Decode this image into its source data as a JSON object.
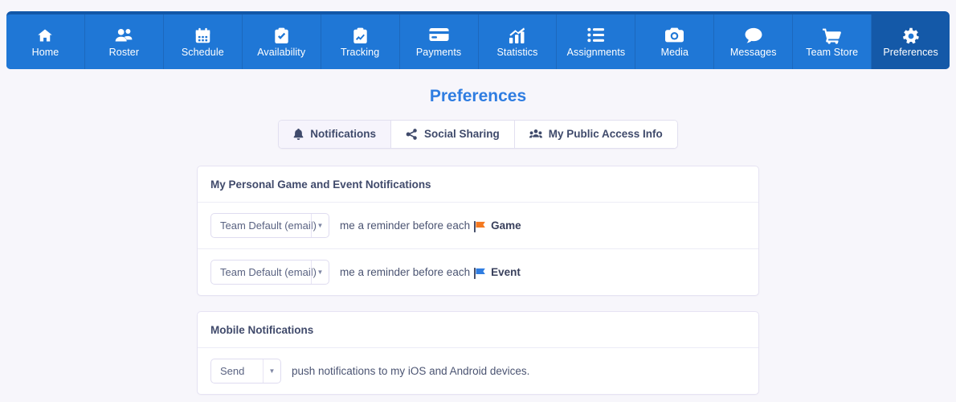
{
  "nav": {
    "items": [
      {
        "label": "Home",
        "icon": "home-icon",
        "active": false
      },
      {
        "label": "Roster",
        "icon": "people-icon",
        "active": false
      },
      {
        "label": "Schedule",
        "icon": "calendar-icon",
        "active": false
      },
      {
        "label": "Availability",
        "icon": "clipboard-check-icon",
        "active": false
      },
      {
        "label": "Tracking",
        "icon": "clipboard-chart-icon",
        "active": false
      },
      {
        "label": "Payments",
        "icon": "credit-card-icon",
        "active": false
      },
      {
        "label": "Statistics",
        "icon": "bar-chart-icon",
        "active": false
      },
      {
        "label": "Assignments",
        "icon": "list-icon",
        "active": false
      },
      {
        "label": "Media",
        "icon": "camera-icon",
        "active": false
      },
      {
        "label": "Messages",
        "icon": "chat-bubble-icon",
        "active": false
      },
      {
        "label": "Team Store",
        "icon": "shopping-cart-icon",
        "active": false
      },
      {
        "label": "Preferences",
        "icon": "gear-icon",
        "active": true
      }
    ]
  },
  "page": {
    "title": "Preferences",
    "title_color": "#2f7de1"
  },
  "tabs": [
    {
      "label": "Notifications",
      "icon": "bell-icon",
      "active": true
    },
    {
      "label": "Social Sharing",
      "icon": "share-icon",
      "active": false
    },
    {
      "label": "My Public Access Info",
      "icon": "group-icon",
      "active": false
    }
  ],
  "cards": [
    {
      "header": "My Personal Game and Event Notifications",
      "rows": [
        {
          "select_value": "Team Default (email)",
          "text_before": "me a reminder before each",
          "flag_icon": "flag-icon",
          "flag_color": "#f47920",
          "label": "Game"
        },
        {
          "select_value": "Team Default (email)",
          "text_before": "me a reminder before each",
          "flag_icon": "flag-icon",
          "flag_color": "#2f7de1",
          "label": "Event"
        }
      ]
    },
    {
      "header": "Mobile Notifications",
      "rows": [
        {
          "select_value": "Send",
          "text_before": "push notifications to my iOS and Android devices.",
          "flag_icon": null,
          "flag_color": null,
          "label": ""
        }
      ]
    }
  ],
  "colors": {
    "nav_bg": "#1f77d6",
    "nav_active": "#1459a8",
    "nav_top_strip": "#1257a8",
    "page_bg": "#f7f6fb",
    "accent": "#2f7de1",
    "game_flag": "#f47920",
    "event_flag": "#2f7de1"
  },
  "caret_glyph": "▼"
}
